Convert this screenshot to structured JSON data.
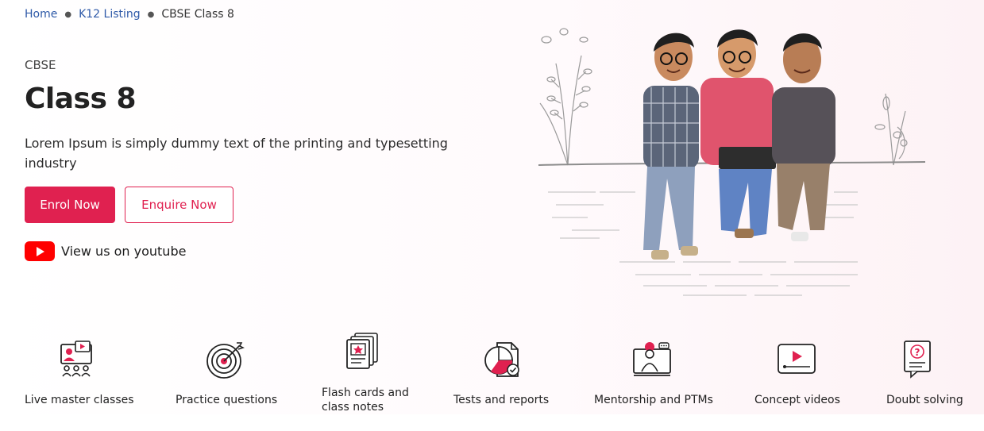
{
  "breadcrumb": {
    "items": [
      "Home",
      "K12 Listing"
    ],
    "current": "CBSE Class 8"
  },
  "hero": {
    "board": "CBSE",
    "title": "Class 8",
    "description": "Lorem Ipsum is simply dummy text of the printing and typesetting industry",
    "enrol_label": "Enrol Now",
    "enquire_label": "Enquire Now",
    "youtube_label": "View us on youtube",
    "illustration_icon": "students-sitting-on-wall-illustration"
  },
  "features": [
    {
      "label": "Live master classes",
      "icon": "live-class-icon"
    },
    {
      "label": "Practice questions",
      "icon": "target-icon"
    },
    {
      "label": "Flash cards and class notes",
      "line1": "Flash cards and",
      "line2": "class notes",
      "icon": "flash-cards-icon"
    },
    {
      "label": "Tests and reports",
      "icon": "report-chart-icon"
    },
    {
      "label": "Mentorship and PTMs",
      "icon": "mentor-icon"
    },
    {
      "label": "Concept videos",
      "icon": "video-player-icon"
    },
    {
      "label": "Doubt solving",
      "icon": "question-doc-icon"
    }
  ],
  "colors": {
    "accent": "#e02150",
    "link": "#2f5aa8",
    "youtube": "#ff0000"
  }
}
